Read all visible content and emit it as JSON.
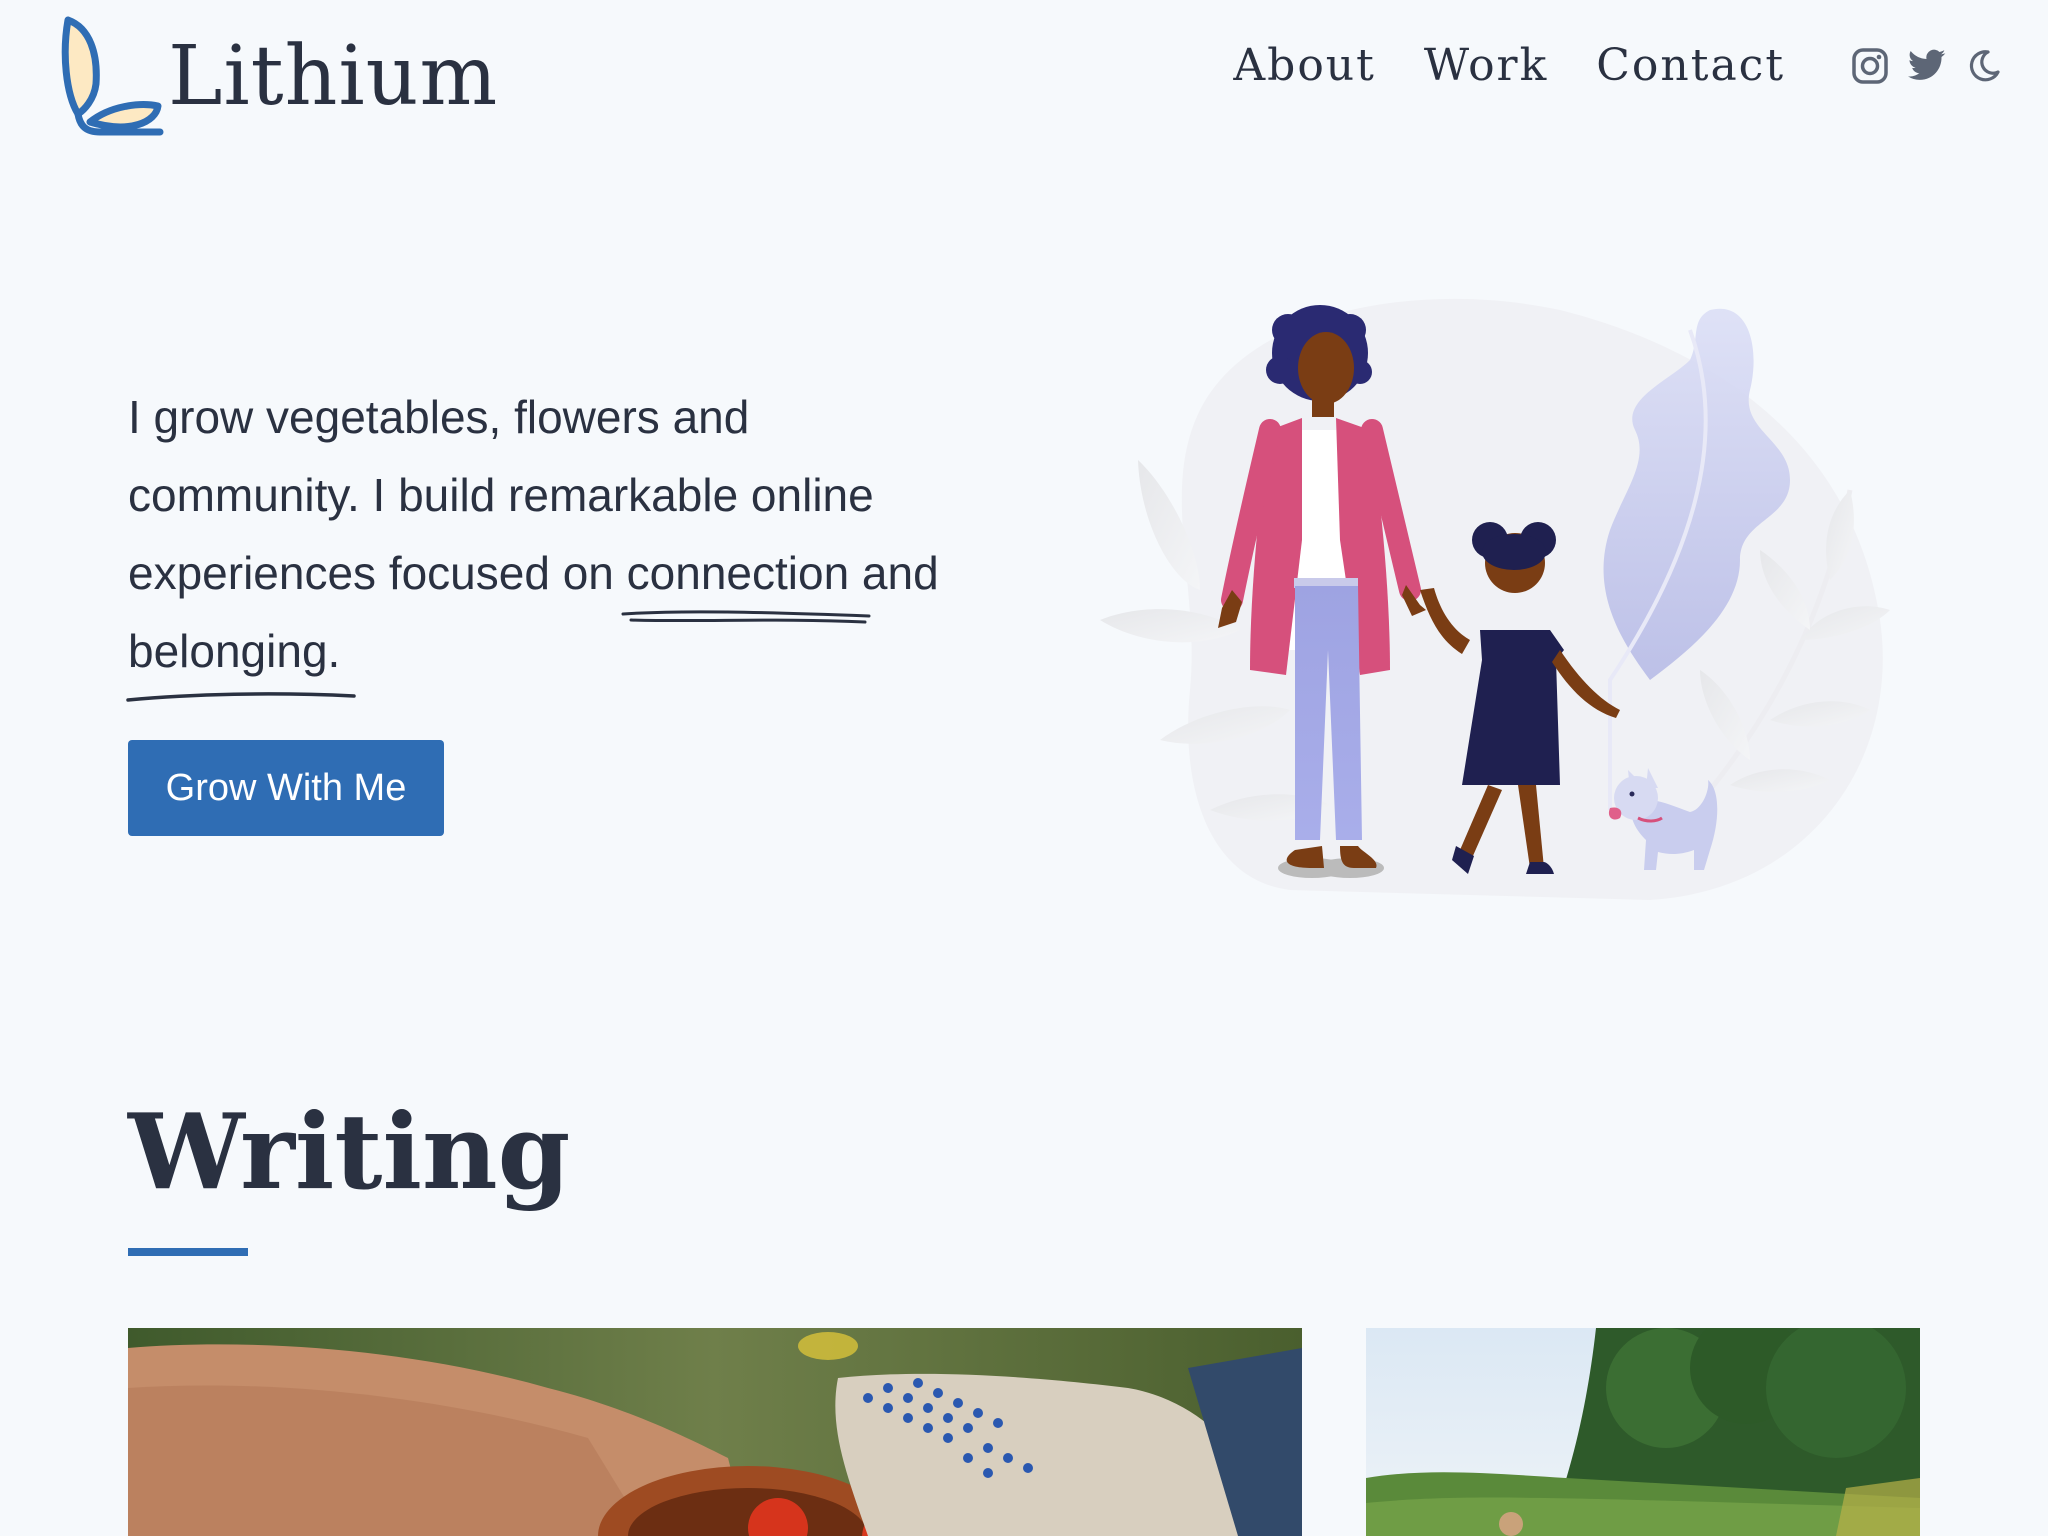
{
  "site": {
    "name": "Lithium",
    "colors": {
      "accent": "#2f6db4",
      "text": "#2a3141",
      "background": "#f6f9fc",
      "logo_fill": "#fde9c3"
    }
  },
  "nav": {
    "links": [
      {
        "label": "About"
      },
      {
        "label": "Work"
      },
      {
        "label": "Contact"
      }
    ],
    "icons": [
      "instagram-icon",
      "twitter-icon",
      "moon-icon"
    ]
  },
  "hero": {
    "text_part1": "I grow vegetables, flowers and community. I build remarkable online experiences focused on ",
    "highlight1": "connection",
    "text_part2": " and ",
    "highlight2": "belonging",
    "text_part3": ".",
    "cta_label": "Grow With Me"
  },
  "writing": {
    "title": "Writing",
    "cards": [
      {
        "image": "hands-holding-bowl-of-tomatoes-photo"
      },
      {
        "image": "green-field-and-trees-photo"
      }
    ]
  }
}
